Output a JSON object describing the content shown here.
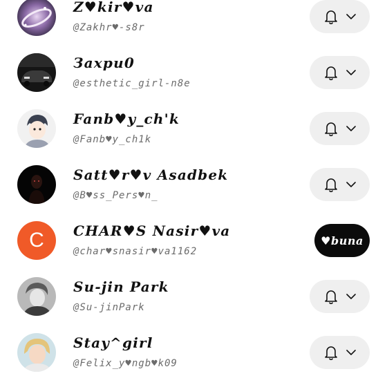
{
  "rows": [
    {
      "name": "Z♥kir♥va",
      "handle": "@Zakhr♥-s8r",
      "action": "notify",
      "avatar": "galaxy-photo"
    },
    {
      "name": "Зaxpи0",
      "handle": "@esthetic_girl-n8e",
      "action": "notify",
      "avatar": "car-photo"
    },
    {
      "name": "Fanb♥y_ch'k",
      "handle": "@Fanb♥y_ch1k",
      "action": "notify",
      "avatar": "anime-boy-drawing"
    },
    {
      "name": "Satt♥r♥v Asadbek",
      "handle": "@B♥ss_Pers♥n_",
      "action": "notify",
      "avatar": "dark-figure-photo"
    },
    {
      "name": "CHAR♥S Nasir♥va",
      "handle": "@char♥snasir♥va1162",
      "action": "follow",
      "avatar_letter": "C",
      "follow_label": "♥buna"
    },
    {
      "name": "Su-jin Park",
      "handle": "@Su-jinPark",
      "action": "notify",
      "avatar": "person-photo"
    },
    {
      "name": "Stay^girl",
      "handle": "@Felix_y♥ngb♥k09",
      "action": "notify",
      "avatar": "blonde-person-photo"
    }
  ],
  "icons": {
    "notify": "bell-icon",
    "chevron": "chevron-down-icon"
  },
  "colors": {
    "letter_avatar": "#f05a28",
    "follow_button": "#0b0b0b",
    "notify_button": "#efefef"
  }
}
